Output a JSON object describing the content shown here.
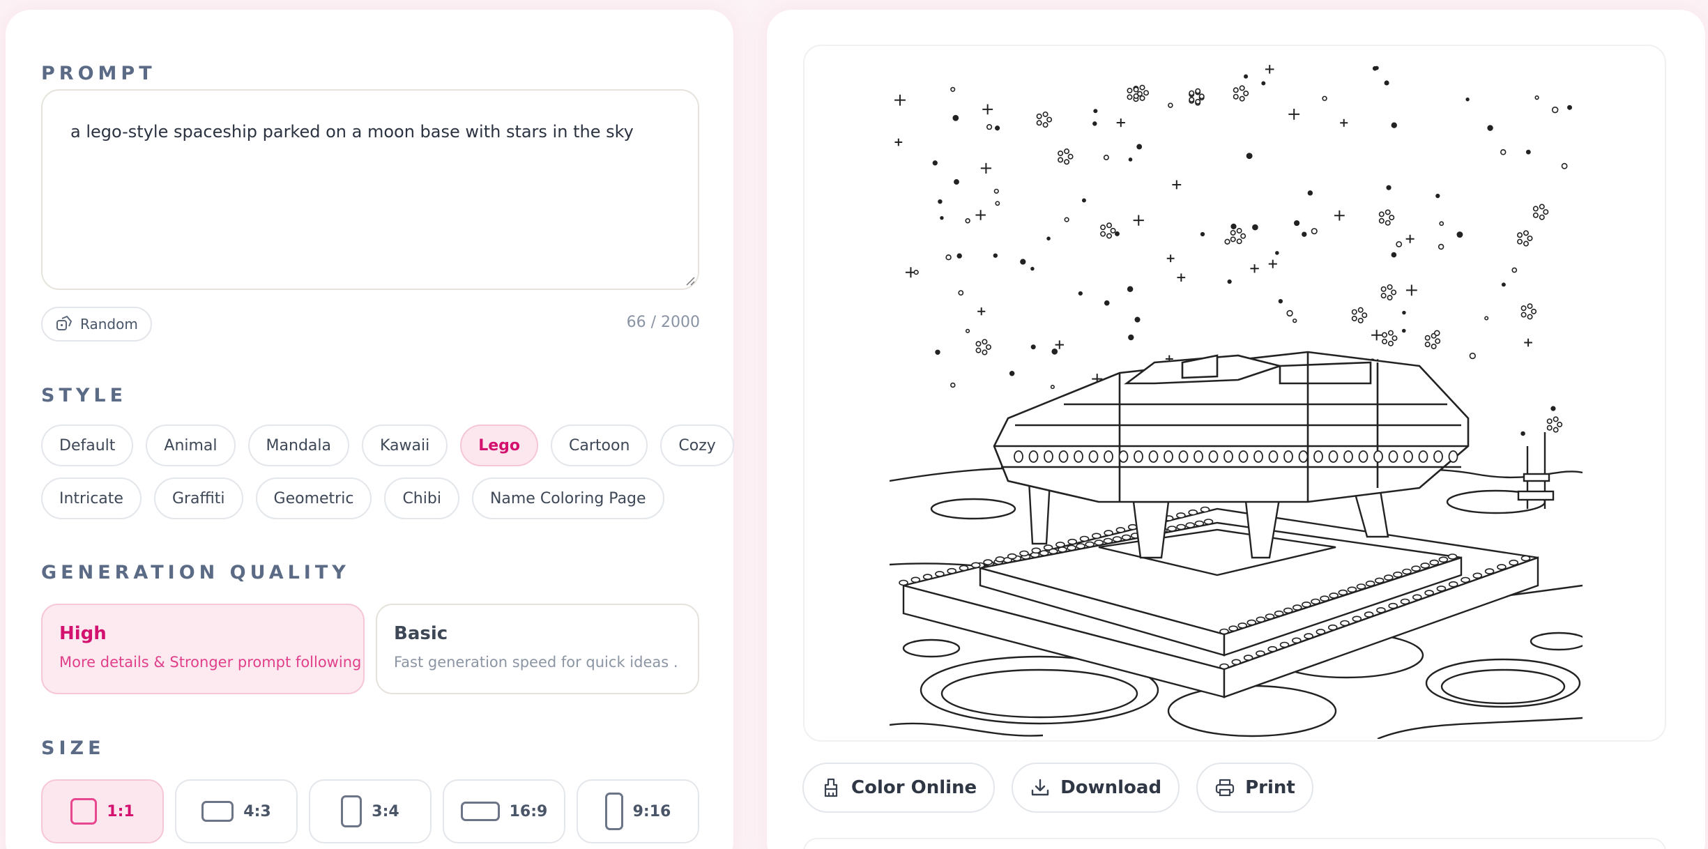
{
  "prompt": {
    "label": "PROMPT",
    "value": "a lego-style spaceship parked on a moon base with stars in the sky",
    "random_label": "Random",
    "char_count": "66 / 2000"
  },
  "style": {
    "label": "STYLE",
    "row1": [
      "Default",
      "Animal",
      "Mandala",
      "Kawaii",
      "Lego",
      "Cartoon",
      "Cozy"
    ],
    "row2": [
      "Intricate",
      "Graffiti",
      "Geometric",
      "Chibi",
      "Name Coloring Page"
    ],
    "selected": "Lego"
  },
  "quality": {
    "label": "GENERATION QUALITY",
    "options": [
      {
        "title": "High",
        "desc": "More details & Stronger prompt following"
      },
      {
        "title": "Basic",
        "desc": "Fast generation speed for quick ideas ."
      }
    ],
    "selected": "High"
  },
  "size": {
    "label": "SIZE",
    "options": [
      "1:1",
      "4:3",
      "3:4",
      "16:9",
      "9:16"
    ],
    "selected": "1:1"
  },
  "actions": {
    "color_online": "Color Online",
    "download": "Download",
    "print": "Print"
  },
  "colors": {
    "accent": "#d3116e",
    "accent_bg": "#fde7ef",
    "page_bg": "#fcf3f6"
  }
}
